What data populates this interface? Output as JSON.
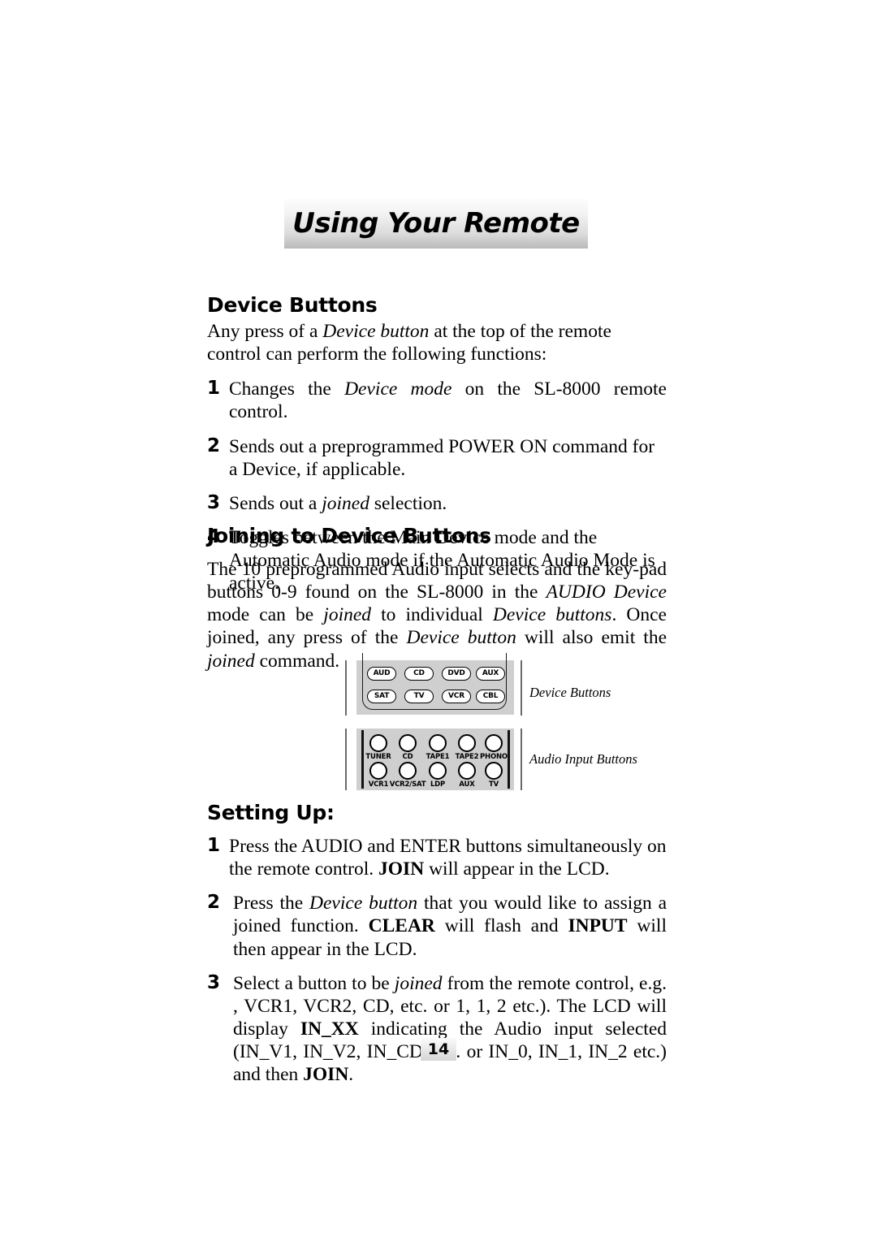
{
  "header": {
    "title": "Using Your Remote"
  },
  "sections": {
    "device_buttons": {
      "heading": "Device Buttons",
      "intro_a": "Any press of a ",
      "intro_b": "Device button",
      "intro_c": " at the top of the remote control can perform the following functions:",
      "items": [
        {
          "num": "1",
          "a": "Changes the ",
          "b": "Device mode",
          "c": " on the SL-8000 remote control."
        },
        {
          "num": "2",
          "a": "Sends out a preprogrammed POWER ON command for a Device, if applicable.",
          "b": "",
          "c": ""
        },
        {
          "num": "3",
          "a": "Sends out a  ",
          "b": "joined",
          "c": " selection."
        },
        {
          "num": "4",
          "a": "Toggles between the Main Device mode and the Automatic Audio mode if the Automatic Audio Mode is active.",
          "b": "",
          "c": ""
        }
      ]
    },
    "joining": {
      "heading": "Joining to Device Buttons",
      "p1": "The 10 preprogrammed Audio input selects and the key-pad buttons 0-9 found on the SL-8000 in the ",
      "p2": "AUDIO Device",
      "p3": " mode can be ",
      "p4": "joined",
      "p5": " to individual ",
      "p6": "Device buttons",
      "p7": ". Once joined, any press of the ",
      "p8": "Device button",
      "p9": " will also emit the ",
      "p10": "joined",
      "p11": " command."
    },
    "setting_up": {
      "heading": "Setting Up:",
      "item1": {
        "num": "1",
        "a": "Press the AUDIO and ENTER buttons simultaneously on the remote control. ",
        "b": "JOIN",
        "c": " will appear in the LCD."
      },
      "item2": {
        "num": "2",
        "a": "Press the ",
        "b": "Device button",
        "c": " that you would like to assign a joined function. ",
        "d": "CLEAR",
        "e": " will flash and ",
        "f": "INPUT",
        "g": " will then appear in the LCD."
      },
      "item3": {
        "num": "3",
        "a": "Select a button to be ",
        "b": "joined",
        "c": " from the remote control, e.g. , VCR1, VCR2, CD, etc. or 1, 1, 2 etc.). The LCD will  display ",
        "d": "IN_XX",
        "e": " indicating the Audio input selected (IN_V1, IN_V2, IN_CD, etc. or IN_0, IN_1, IN_2 etc.) and then ",
        "f": "JOIN",
        "g": "."
      }
    }
  },
  "diagram": {
    "device_panel": {
      "annotation": "Device Buttons",
      "row1": [
        "AUD",
        "CD",
        "DVD",
        "AUX"
      ],
      "row2": [
        "SAT",
        "TV",
        "VCR",
        "CBL"
      ]
    },
    "audio_panel": {
      "annotation": "Audio Input Buttons",
      "row1": [
        "TUNER",
        "CD",
        "TAPE1",
        "TAPE2",
        "PHONO"
      ],
      "row2": [
        "VCR1",
        "VCR2/SAT",
        "LDP",
        "AUX",
        "TV"
      ]
    }
  },
  "footer": {
    "page_number": "14"
  },
  "colors": {
    "panel_gray": "#cfcfcf",
    "banner_light": "#fdfdfd",
    "banner_dark": "#b9b9b9",
    "text": "#000000"
  }
}
